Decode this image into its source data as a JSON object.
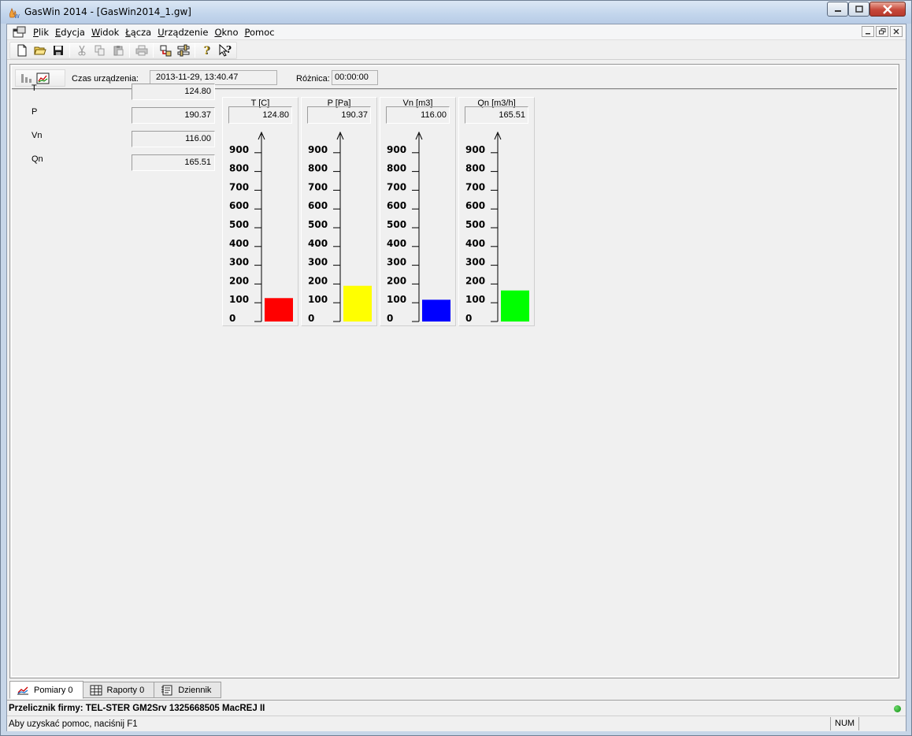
{
  "window": {
    "title": "GasWin 2014 - [GasWin2014_1.gw]"
  },
  "menu": {
    "items": [
      {
        "u": "P",
        "rest": "lik"
      },
      {
        "u": "E",
        "rest": "dycja"
      },
      {
        "u": "W",
        "rest": "idok"
      },
      {
        "u": "Ł",
        "rest": "ącza"
      },
      {
        "u": "U",
        "rest": "rządzenie"
      },
      {
        "u": "O",
        "rest": "kno"
      },
      {
        "u": "P",
        "rest": "omoc"
      }
    ]
  },
  "info": {
    "czas_label": "Czas urządzenia:",
    "czas_value": "2013-11-29, 13:40.47",
    "roznica_label": "Różnica:",
    "roznica_value": "00:00:00"
  },
  "variables": [
    {
      "name": "T",
      "value": "124.80"
    },
    {
      "name": "P",
      "value": "190.37"
    },
    {
      "name": "Vn",
      "value": "116.00"
    },
    {
      "name": "Qn",
      "value": "165.51"
    }
  ],
  "gauges": [
    {
      "title": "T [C]",
      "value_text": "124.80",
      "value": 124.8,
      "color": "#ff0000"
    },
    {
      "title": "P [Pa]",
      "value_text": "190.37",
      "value": 190.37,
      "color": "#ffff00"
    },
    {
      "title": "Vn [m3]",
      "value_text": "116.00",
      "value": 116.0,
      "color": "#0000ff"
    },
    {
      "title": "Qn [m3/h]",
      "value_text": "165.51",
      "value": 165.51,
      "color": "#00ff00"
    }
  ],
  "gauge_scale": {
    "max": 1000,
    "ticks": [
      "0",
      "100",
      "200",
      "300",
      "400",
      "500",
      "600",
      "700",
      "800",
      "900"
    ]
  },
  "tabs": [
    {
      "label": "Pomiary 0",
      "active": true
    },
    {
      "label": "Raporty 0",
      "active": false
    },
    {
      "label": "Dziennik",
      "active": false
    }
  ],
  "status": {
    "device": "Przelicznik firmy: TEL-STER GM2Srv 1325668505 MacREJ II",
    "help": "Aby uzyskać pomoc, naciśnij F1",
    "num": "NUM",
    "led_color": "#0a8a0a"
  }
}
